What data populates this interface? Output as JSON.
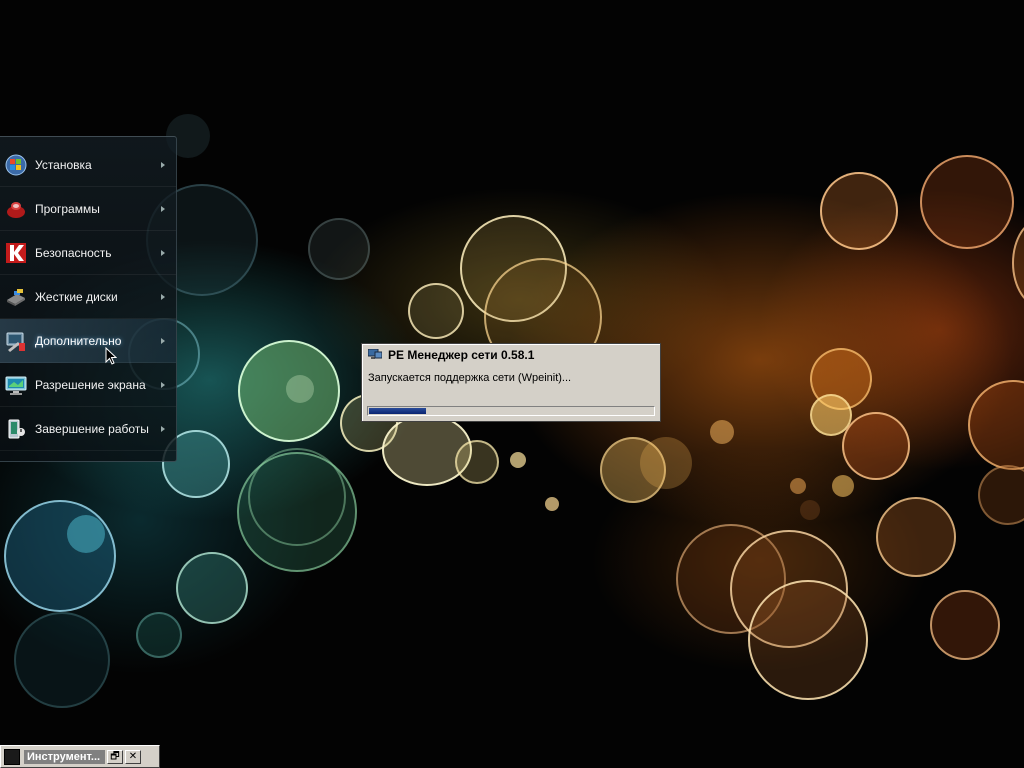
{
  "side_menu": {
    "items": [
      {
        "label": "Установка",
        "icon": "windows-install-icon"
      },
      {
        "label": "Программы",
        "icon": "programs-icon"
      },
      {
        "label": "Безопасность",
        "icon": "kaspersky-icon"
      },
      {
        "label": "Жесткие диски",
        "icon": "hard-disk-icon"
      },
      {
        "label": "Дополнительно",
        "icon": "additional-tools-icon",
        "active": true
      },
      {
        "label": "Разрешение экрана",
        "icon": "monitor-icon"
      },
      {
        "label": "Завершение работы",
        "icon": "shutdown-icon"
      }
    ]
  },
  "dialog": {
    "title": "PE Менеджер сети 0.58.1",
    "message": "Запускается поддержка сети (Wpeinit)...",
    "progress": 0.2,
    "accent_color": "#0a2470"
  },
  "taskbar": {
    "window_label": "Инструмент...",
    "buttons": {
      "restore": "🗗",
      "close": "✕"
    }
  },
  "colors": {
    "background": "#030303",
    "dialog_face": "#d4d0c8"
  }
}
